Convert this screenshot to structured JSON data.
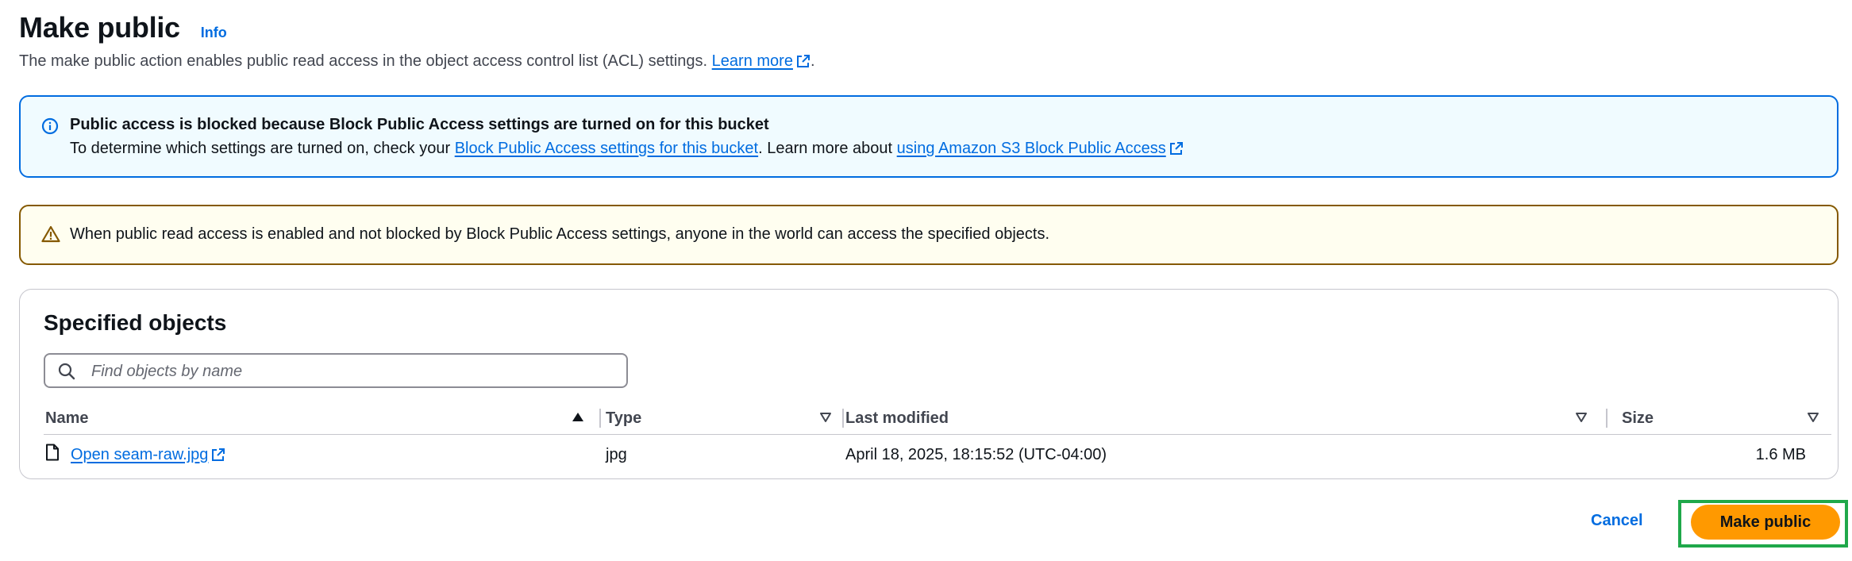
{
  "header": {
    "title": "Make public",
    "info_label": "Info",
    "description_text": "The make public action enables public read access in the object access control list (ACL) settings.",
    "learn_more_label": "Learn more",
    "description_suffix": "."
  },
  "info_alert": {
    "title": "Public access is blocked because Block Public Access settings are turned on for this bucket",
    "body_prefix": "To determine which settings are turned on, check your",
    "link1_label": "Block Public Access settings for this bucket",
    "body_middle": ". Learn more about",
    "link2_label": "using Amazon S3 Block Public Access",
    "icon": "info-icon"
  },
  "warning_alert": {
    "body": "When public read access is enabled and not blocked by Block Public Access settings, anyone in the world can access the specified objects.",
    "icon": "warning-icon"
  },
  "objects": {
    "title": "Specified objects",
    "search": {
      "placeholder": "Find objects by name",
      "value": ""
    },
    "columns": [
      {
        "label": "Name",
        "sort": "ascending"
      },
      {
        "label": "Type",
        "sort": "none"
      },
      {
        "label": "Last modified",
        "sort": "none"
      },
      {
        "label": "Size",
        "sort": "none"
      }
    ],
    "rows": [
      {
        "name": "Open seam-raw.jpg",
        "type": "jpg",
        "last_modified": "April 18, 2025, 18:15:52 (UTC-04:00)",
        "size": "1.6 MB"
      }
    ]
  },
  "footer": {
    "cancel_label": "Cancel",
    "primary_label": "Make public"
  },
  "colors": {
    "link": "#006ce0",
    "primary": "#ff9900",
    "info_border": "#006ce0",
    "info_bg": "#f0fbff",
    "warning_border": "#855900",
    "warning_bg": "#fffef0",
    "highlight": "#1fa84a"
  }
}
